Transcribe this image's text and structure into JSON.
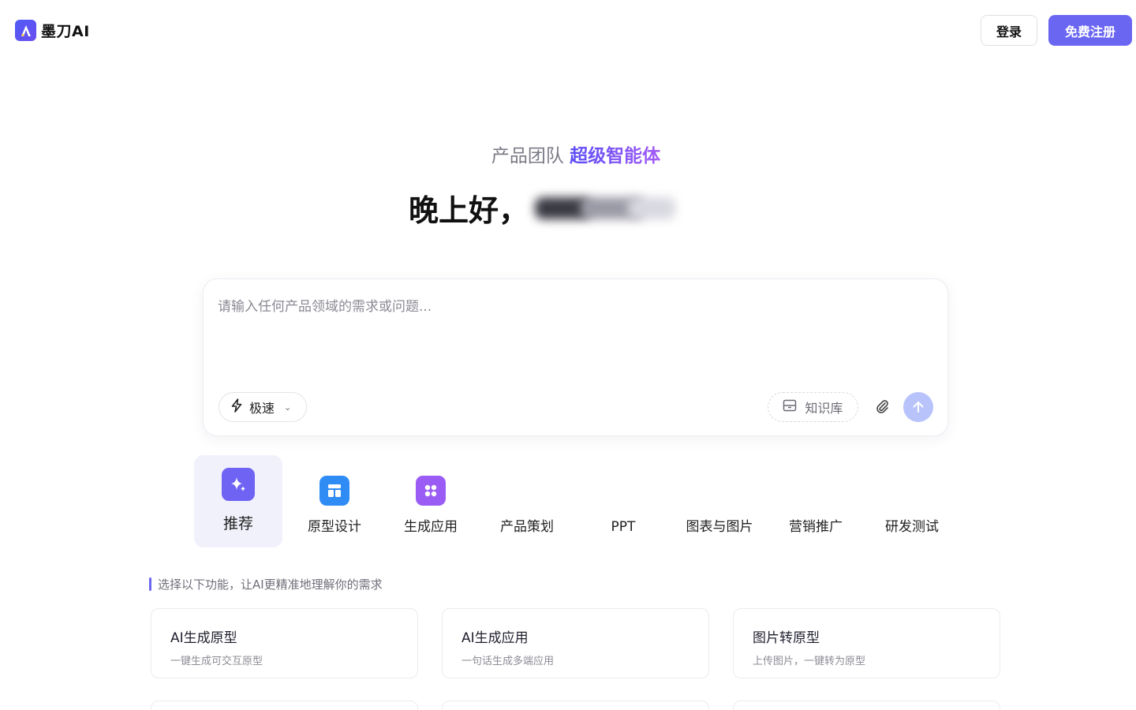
{
  "header": {
    "logo_text": "墨刀AI",
    "login_label": "登录",
    "register_label": "免费注册"
  },
  "hero": {
    "tagline_prefix": "产品团队",
    "tagline_highlight": "超级智能体",
    "greeting": "晚上好，"
  },
  "composer": {
    "placeholder": "请输入任何产品领域的需求或问题...",
    "mode_label": "极速",
    "knowledge_label": "知识库"
  },
  "tabs": [
    {
      "label": "推荐",
      "icon": "sparkle-icon",
      "active": true
    },
    {
      "label": "原型设计",
      "icon": "layout-icon"
    },
    {
      "label": "生成应用",
      "icon": "apps-icon"
    },
    {
      "label": "产品策划"
    },
    {
      "label": "PPT"
    },
    {
      "label": "图表与图片"
    },
    {
      "label": "营销推广"
    },
    {
      "label": "研发测试"
    }
  ],
  "section_hint": "选择以下功能，让AI更精准地理解你的需求",
  "cards": [
    {
      "title": "AI生成原型",
      "desc": "一键生成可交互原型"
    },
    {
      "title": "AI生成应用",
      "desc": "一句话生成多端应用"
    },
    {
      "title": "图片转原型",
      "desc": "上传图片，一键转为原型"
    }
  ],
  "colors": {
    "brand": "#6b66f2",
    "send_disabled": "#b8c3fb",
    "active_tab_bg": "#f1f1fc"
  }
}
